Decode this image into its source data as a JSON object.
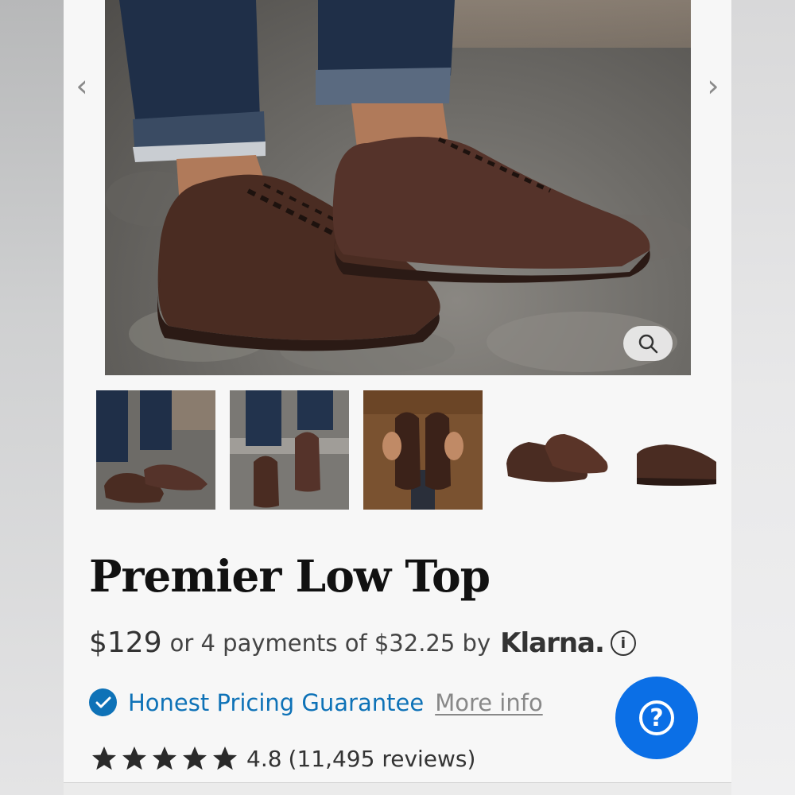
{
  "gallery": {
    "prev_arrow": "‹",
    "next_arrow": "›",
    "main_image_icon": "zoom-icon",
    "thumbnails": [
      {
        "name": "thumb-cobblestone-side"
      },
      {
        "name": "thumb-stairs-front"
      },
      {
        "name": "thumb-held-pair"
      },
      {
        "name": "thumb-pair-studio"
      },
      {
        "name": "thumb-side-studio"
      }
    ]
  },
  "product": {
    "title": "Premier Low Top",
    "price": "$129",
    "installments": "or 4 payments of $32.25 by",
    "klarna": "Klarna.",
    "info_symbol": "i",
    "guarantee_label": "Honest Pricing Guarantee",
    "more_info": "More info",
    "rating_value": "4.8",
    "review_count": "(11,495 reviews)",
    "star_count": 5
  },
  "help": {
    "symbol": "?"
  },
  "colors": {
    "accent_blue": "#0e72b7",
    "help_blue": "#0b6fe6",
    "leather_brown": "#4a2c22"
  }
}
